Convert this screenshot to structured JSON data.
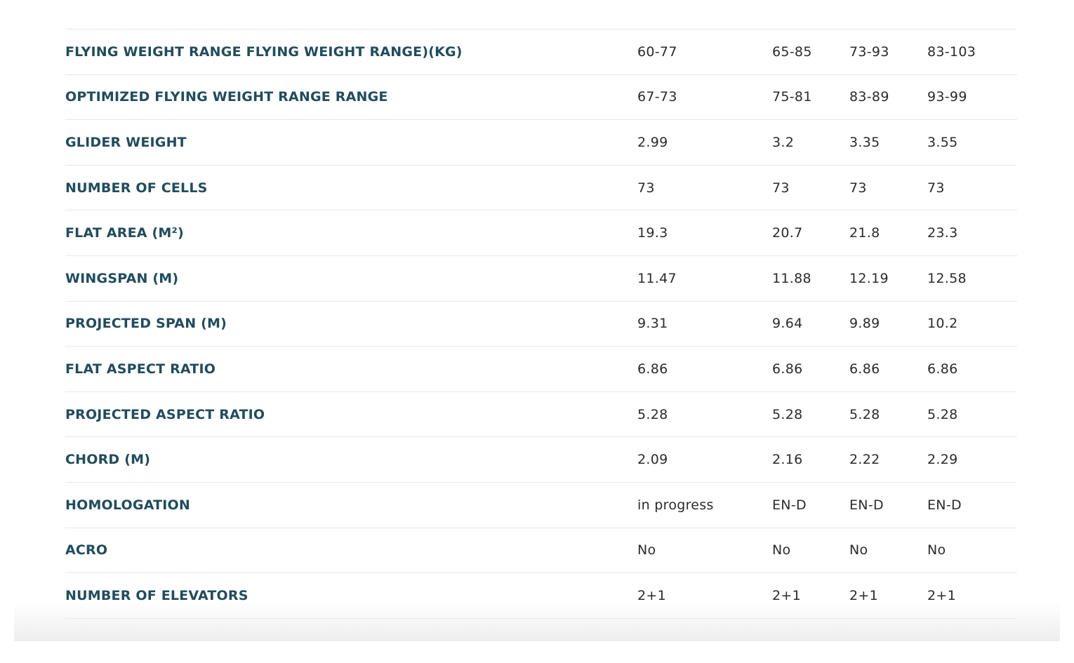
{
  "spec_table": {
    "rows": [
      {
        "label": "FLYING WEIGHT RANGE FLYING WEIGHT RANGE)(KG)",
        "values": [
          "60-77",
          "65-85",
          "73-93",
          "83-103"
        ]
      },
      {
        "label": "OPTIMIZED FLYING WEIGHT RANGE RANGE",
        "values": [
          "67-73",
          "75-81",
          "83-89",
          "93-99"
        ]
      },
      {
        "label": "GLIDER WEIGHT",
        "values": [
          "2.99",
          "3.2",
          "3.35",
          "3.55"
        ]
      },
      {
        "label": "NUMBER OF CELLS",
        "values": [
          "73",
          "73",
          "73",
          "73"
        ]
      },
      {
        "label": "FLAT AREA (M²)",
        "values": [
          "19.3",
          "20.7",
          "21.8",
          "23.3"
        ]
      },
      {
        "label": "WINGSPAN (M)",
        "values": [
          "11.47",
          "11.88",
          "12.19",
          "12.58"
        ]
      },
      {
        "label": "PROJECTED SPAN (M)",
        "values": [
          "9.31",
          "9.64",
          "9.89",
          "10.2"
        ]
      },
      {
        "label": "FLAT ASPECT RATIO",
        "values": [
          "6.86",
          "6.86",
          "6.86",
          "6.86"
        ]
      },
      {
        "label": "PROJECTED ASPECT RATIO",
        "values": [
          "5.28",
          "5.28",
          "5.28",
          "5.28"
        ]
      },
      {
        "label": "CHORD (M)",
        "values": [
          "2.09",
          "2.16",
          "2.22",
          "2.29"
        ]
      },
      {
        "label": "HOMOLOGATION",
        "values": [
          "in progress",
          "EN-D",
          "EN-D",
          "EN-D"
        ]
      },
      {
        "label": "ACRO",
        "values": [
          "No",
          "No",
          "No",
          "No"
        ]
      },
      {
        "label": "NUMBER OF ELEVATORS",
        "values": [
          "2+1",
          "2+1",
          "2+1",
          "2+1"
        ]
      }
    ]
  },
  "colors": {
    "label": "#214c5d",
    "value": "#2b2b2b",
    "divider": "#e4e7e9",
    "background": "#ffffff"
  }
}
